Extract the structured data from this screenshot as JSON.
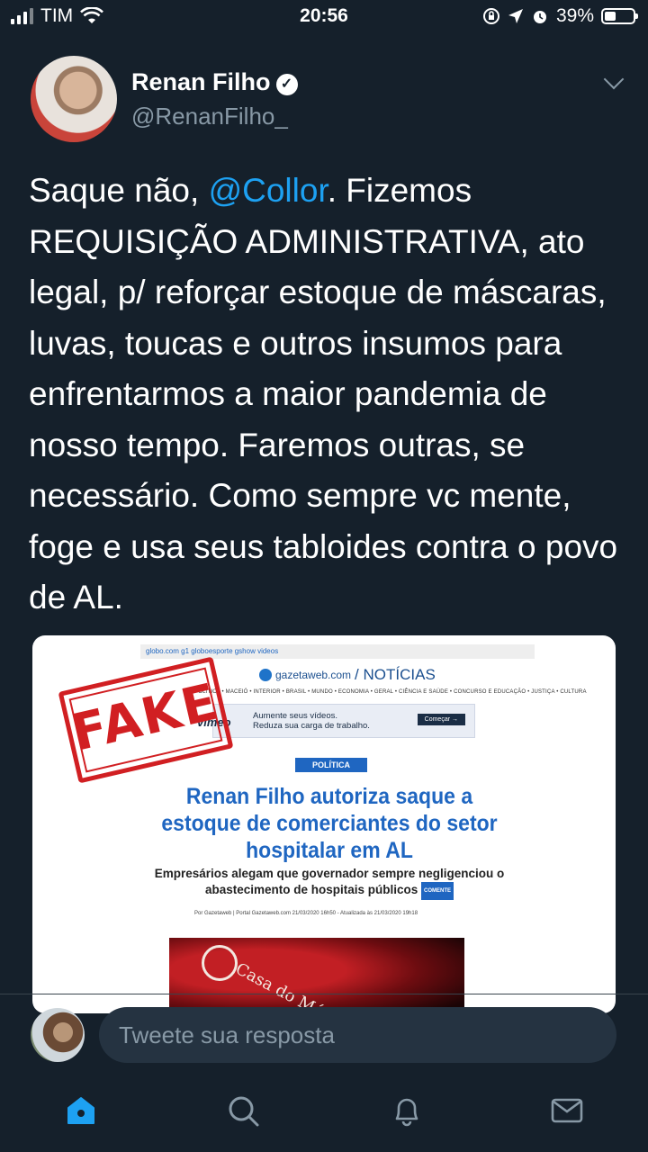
{
  "status_bar": {
    "carrier": "TIM",
    "time": "20:56",
    "battery": "39%",
    "battery_level": 0.39
  },
  "tweet": {
    "display_name": "Renan Filho",
    "handle": "@RenanFilho_",
    "text_before_mention": "Saque não, ",
    "mention": "@Collor",
    "text_after_mention": ". Fizemos REQUISIÇÃO ADMINISTRATIVA, ato legal, p/ reforçar estoque de máscaras, luvas, toucas e outros insumos para enfrentarmos a maior pandemia de nosso tempo. Faremos outras, se necessário. Como sempre vc mente, foge e usa seus tabloides contra o povo de AL."
  },
  "media": {
    "top_links": "globo.com  g1  globoesporte  gshow  videos",
    "site_name": "gazetaweb.com",
    "section": "/ NOTÍCIAS",
    "nav": "POLÍTICA • MACEIÓ • INTERIOR • BRASIL • MUNDO • ECONOMIA • GERAL • CIÊNCIA E SAÚDE • CONCURSO E EDUCAÇÃO • JUSTIÇA • CULTURA",
    "ad_brand": "vimeo",
    "ad_line1": "Aumente seus vídeos.",
    "ad_line2": "Reduza sua carga de trabalho.",
    "ad_button": "Começar →",
    "tag": "POLÍTICA",
    "headline": "Renan Filho autoriza saque a estoque de comerciantes do setor hospitalar em AL",
    "subheadline": "Empresários alegam que governador sempre negligenciou o abastecimento de hospitais públicos",
    "comment_badge": "COMENTE",
    "meta": "Por Gazetaweb | Portal Gazetaweb.com   21/03/2020 16h50 - Atualizada às 21/03/2020 19h18",
    "photo_text": "Casa do Méd",
    "stamp": "FAKE"
  },
  "reply": {
    "placeholder": "Tweete sua resposta"
  },
  "colors": {
    "background": "#15202b",
    "accent": "#1da1f2",
    "secondary_text": "#8899a6",
    "stamp_red": "#d11f22"
  },
  "nav_icons": [
    "home-icon",
    "search-icon",
    "notifications-icon",
    "messages-icon"
  ]
}
